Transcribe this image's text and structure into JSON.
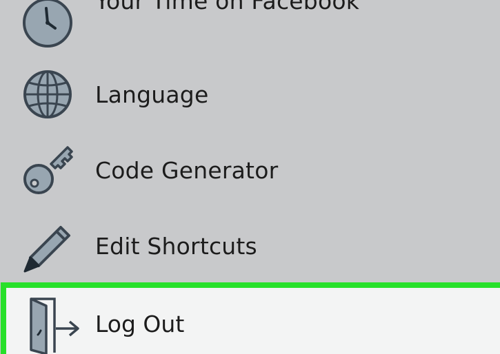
{
  "menu": {
    "items": [
      {
        "label": "Your Time on Facebook",
        "icon": "clock-icon"
      },
      {
        "label": "Language",
        "icon": "globe-icon"
      },
      {
        "label": "Code Generator",
        "icon": "key-icon"
      },
      {
        "label": "Edit Shortcuts",
        "icon": "pencil-icon"
      },
      {
        "label": "Log Out",
        "icon": "logout-door-icon"
      }
    ],
    "highlighted_item": "Log Out"
  },
  "colors": {
    "background": "#c8c9cb",
    "highlight_border": "#27e02a",
    "highlight_fill": "#f3f4f4",
    "icon_fill": "#98a6b1",
    "icon_stroke": "#3a4550",
    "text": "#1c1c1c"
  }
}
